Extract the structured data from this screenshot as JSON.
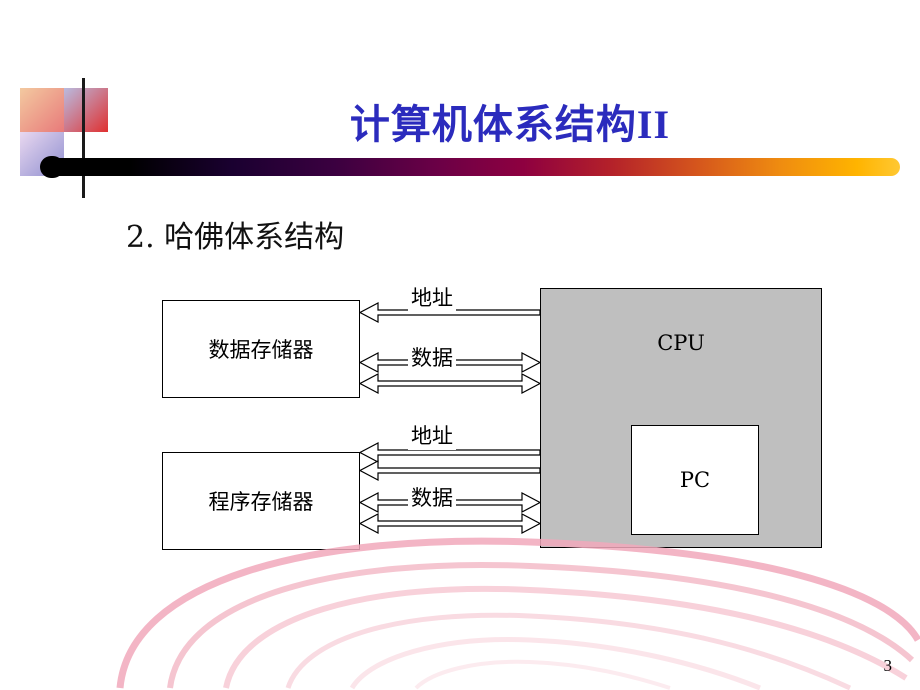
{
  "slide": {
    "title_cn": "计算机体系结构",
    "title_suffix": "II",
    "subheading": "2. 哈佛体系结构",
    "page_number": "3"
  },
  "diagram": {
    "boxes": [
      {
        "id": "data-memory",
        "label": "数据存储器"
      },
      {
        "id": "program-memory",
        "label": "程序存储器"
      },
      {
        "id": "cpu",
        "label": "CPU"
      },
      {
        "id": "pc",
        "label": "PC"
      }
    ],
    "bus_labels": [
      {
        "id": "address-bus-data",
        "label": "地址"
      },
      {
        "id": "data-bus-data",
        "label": "数据"
      },
      {
        "id": "address-bus-program",
        "label": "地址"
      },
      {
        "id": "data-bus-program",
        "label": "数据"
      }
    ]
  },
  "colors": {
    "title": "#2b2bbd",
    "cpu_fill": "#bfbfbf",
    "rule_start": "#000000",
    "rule_end": "#ffb400",
    "swirl": "#f3b3c0"
  }
}
